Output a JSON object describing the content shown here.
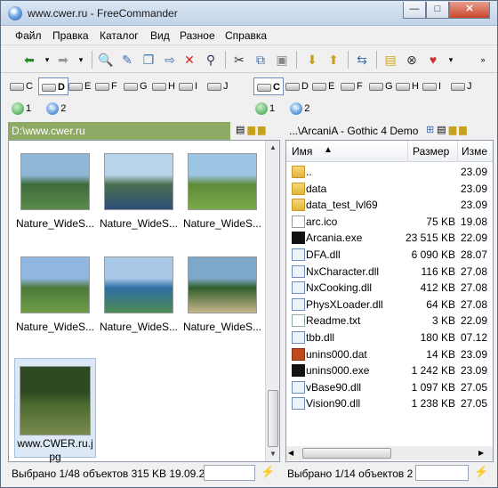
{
  "window": {
    "title": "www.cwer.ru - FreeCommander",
    "min": "—",
    "max": "□",
    "close": "✕"
  },
  "menu": [
    "Файл",
    "Правка",
    "Каталог",
    "Вид",
    "Разное",
    "Справка"
  ],
  "toolbar": {
    "icons": [
      "back-icon",
      "forward-icon",
      "search-icon",
      "edit-icon",
      "copy-icon",
      "move-icon",
      "delete-icon",
      "find-icon",
      "cut-icon",
      "copy-clip-icon",
      "paste-icon",
      "pack-icon",
      "unpack-icon",
      "compare-icon",
      "new-folder-icon",
      "binoculars-icon",
      "favorites-icon"
    ]
  },
  "drives_left": [
    "C",
    "D",
    "E",
    "F",
    "G",
    "H",
    "I",
    "J"
  ],
  "drives_right": [
    "C",
    "D",
    "E",
    "F",
    "G",
    "H",
    "I",
    "J"
  ],
  "net_left": [
    "1",
    "2"
  ],
  "net_right": [
    "1",
    "2"
  ],
  "left_panel": {
    "path": "D:\\www.cwer.ru",
    "thumbs": [
      {
        "label": "Nature_WideS...",
        "colors": [
          "#8fb8d8",
          "#3d6b3a",
          "#5a8b4c"
        ]
      },
      {
        "label": "Nature_WideS...",
        "colors": [
          "#b9d3e8",
          "#4b6f4f",
          "#2c4f7a"
        ]
      },
      {
        "label": "Nature_WideS...",
        "colors": [
          "#9cc4e3",
          "#5e8d3a",
          "#7aa84a"
        ]
      },
      {
        "label": "Nature_WideS...",
        "colors": [
          "#8fb7e0",
          "#4d7a3b",
          "#6e9d47"
        ]
      },
      {
        "label": "Nature_WideS...",
        "colors": [
          "#a7c9e7",
          "#2f6fa3",
          "#4e8a54"
        ]
      },
      {
        "label": "Nature_WideS...",
        "colors": [
          "#7ea8c9",
          "#2f5e2b",
          "#c7b68c"
        ]
      },
      {
        "label": "www.CWER.ru.jpg",
        "colors": [
          "#2d4a22",
          "#4c6a30",
          "#7a8a50"
        ]
      }
    ],
    "status": "Выбрано 1/48 объектов   315 KB  19.09.2"
  },
  "right_panel": {
    "path": "...\\ArcaniA - Gothic 4 Demo",
    "headers": {
      "name": "Имя",
      "size": "Размер",
      "date": "Изме"
    },
    "files": [
      {
        "name": "..",
        "size": "",
        "date": "23.09",
        "type": "folder"
      },
      {
        "name": "data",
        "size": "",
        "date": "23.09",
        "type": "folder"
      },
      {
        "name": "data_test_lvl69",
        "size": "",
        "date": "23.09",
        "type": "folder"
      },
      {
        "name": "arc.ico",
        "size": "75 KB",
        "date": "19.08",
        "type": "file"
      },
      {
        "name": "Arcania.exe",
        "size": "23 515 KB",
        "date": "22.09",
        "type": "exe"
      },
      {
        "name": "DFA.dll",
        "size": "6 090 KB",
        "date": "28.07",
        "type": "dll"
      },
      {
        "name": "NxCharacter.dll",
        "size": "116 KB",
        "date": "27.08",
        "type": "dll"
      },
      {
        "name": "NxCooking.dll",
        "size": "412 KB",
        "date": "27.08",
        "type": "dll"
      },
      {
        "name": "PhysXLoader.dll",
        "size": "64 KB",
        "date": "27.08",
        "type": "dll"
      },
      {
        "name": "Readme.txt",
        "size": "3 KB",
        "date": "22.09",
        "type": "txt"
      },
      {
        "name": "tbb.dll",
        "size": "180 KB",
        "date": "07.12",
        "type": "dll"
      },
      {
        "name": "unins000.dat",
        "size": "14 KB",
        "date": "23.09",
        "type": "dat"
      },
      {
        "name": "unins000.exe",
        "size": "1 242 KB",
        "date": "23.09",
        "type": "exe"
      },
      {
        "name": "vBase90.dll",
        "size": "1 097 KB",
        "date": "27.05",
        "type": "dll"
      },
      {
        "name": "Vision90.dll",
        "size": "1 238 KB",
        "date": "27.05",
        "type": "dll"
      }
    ],
    "status": "Выбрано 1/14 объектов  2"
  }
}
